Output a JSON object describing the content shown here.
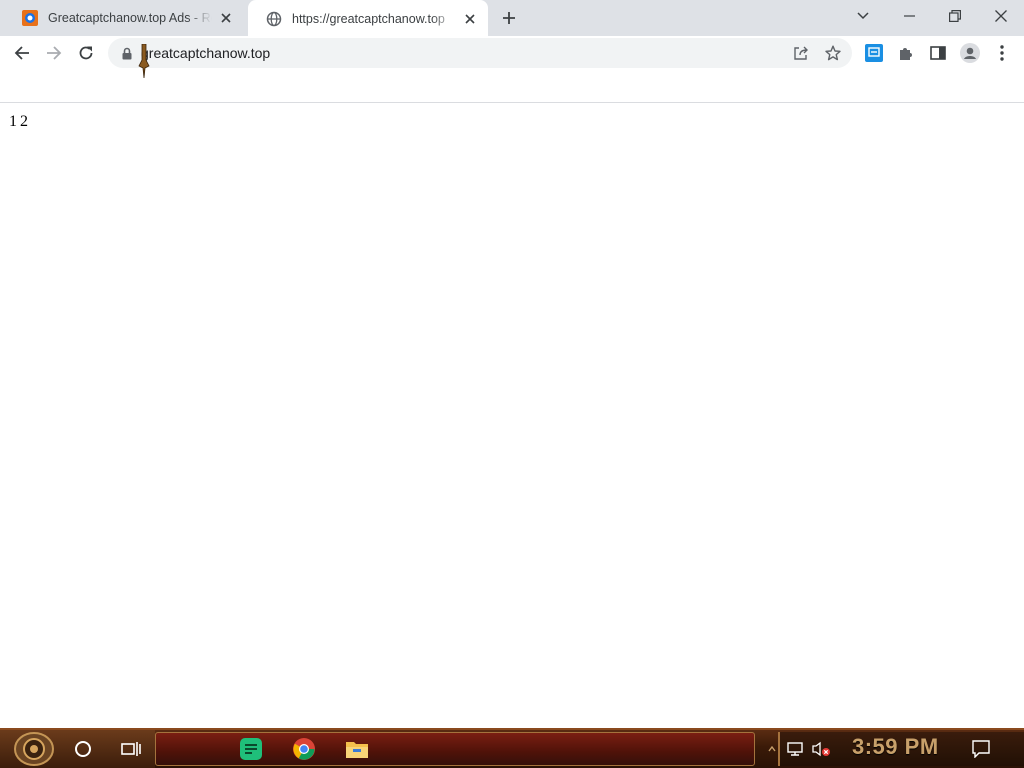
{
  "browser": {
    "tabs": [
      {
        "title": "Greatcaptchanow.top Ads - Re",
        "active": false
      },
      {
        "title": "https://greatcaptchanow.top",
        "active": true
      }
    ],
    "address_bar": {
      "url": "greatcaptchanow.top"
    }
  },
  "page": {
    "items": [
      "1",
      "2"
    ]
  },
  "taskbar": {
    "clock": "3:59 PM",
    "pinned_apps": [
      "notes-app-icon",
      "chrome-icon",
      "file-explorer-icon"
    ]
  },
  "colors": {
    "tabstrip_bg": "#dee1e6",
    "omnibox_bg": "#f1f3f4",
    "taskbar_accent": "#a5733d",
    "clock_color": "#c8a06a"
  }
}
